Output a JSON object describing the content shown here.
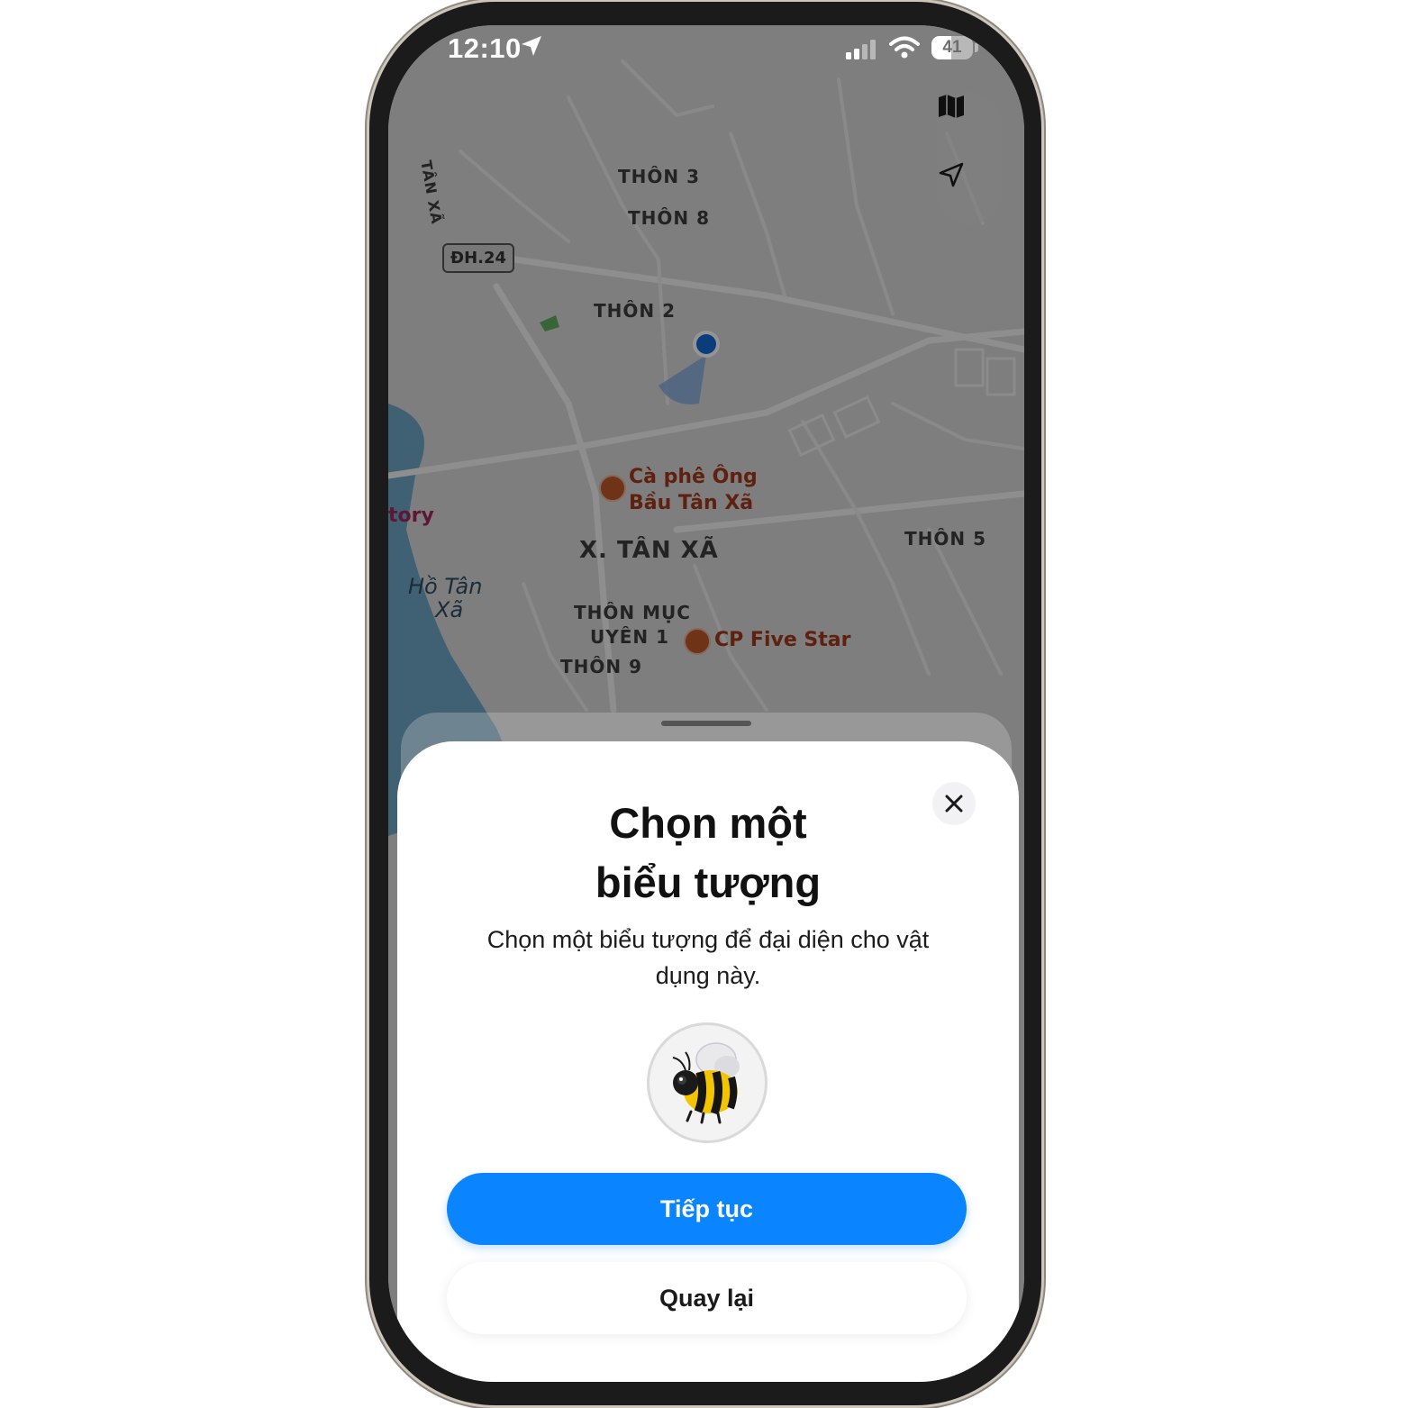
{
  "status_bar": {
    "time": "12:10",
    "battery": "41"
  },
  "map": {
    "road_label": "ĐH.24",
    "vertical_label": "TÂN XÃ",
    "areas": {
      "thon3": "THÔN 3",
      "thon8": "THÔN 8",
      "thon2": "THÔN 2",
      "commune": "X. TÂN XÃ",
      "thon5": "THÔN 5",
      "muc_uyen_line1": "THÔN MỤC",
      "muc_uyen_line2": "UYÊN 1",
      "thon9": "THÔN 9"
    },
    "pois": {
      "cafe_line1": "Cà phê Ông",
      "cafe_line2": "Bầu Tân Xã",
      "five_star": "CP Five Star",
      "partial": "tory"
    },
    "lake_line1": "Hồ Tân",
    "lake_line2": "Xã"
  },
  "sheet": {
    "title_line1": "Chọn một",
    "title_line2": "biểu tượng",
    "subtitle_line1": "Chọn một biểu tượng để đại diện cho vật",
    "subtitle_line2": "dụng này.",
    "selected_icon": "bee-emoji",
    "continue_label": "Tiếp tục",
    "back_label": "Quay lại"
  },
  "colors": {
    "accent": "#0a84ff",
    "location_dot": "#1468d6",
    "poi": "#c0592a"
  }
}
